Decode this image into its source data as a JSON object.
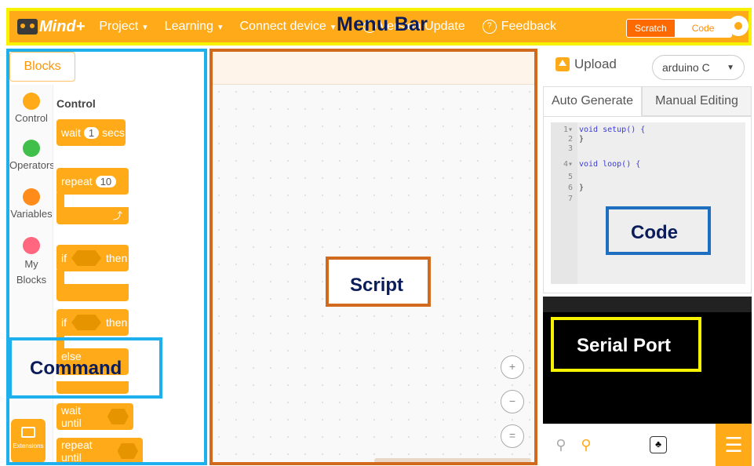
{
  "menubar": {
    "brand": "Mind+",
    "items": [
      {
        "label": "Project",
        "caret": "▾"
      },
      {
        "label": "Learning",
        "caret": "▾"
      },
      {
        "label": "Connect device",
        "caret": "▾"
      }
    ],
    "version_update": "Version Update",
    "feedback": "Feedback",
    "mode_scratch": "Scratch",
    "mode_code": "Code",
    "annotation": "Menu Bar"
  },
  "blocks_panel": {
    "tab": "Blocks",
    "categories": [
      {
        "label": "Control",
        "color": "#ffab19"
      },
      {
        "label": "Operators",
        "color": "#40bf4a"
      },
      {
        "label": "Variables",
        "color": "#ff8c1a"
      },
      {
        "label": "My Blocks",
        "color": "#ff6680"
      }
    ],
    "heading": "Control",
    "blocks": {
      "wait": {
        "prefix": "wait",
        "value": "1",
        "suffix": "secs"
      },
      "repeat": {
        "prefix": "repeat",
        "value": "10"
      },
      "if_then": {
        "prefix": "if",
        "suffix": "then"
      },
      "if_then_else": {
        "prefix": "if",
        "suffix": "then",
        "else": "else"
      },
      "wait_until": "wait until",
      "repeat_until": "repeat until"
    },
    "extensions": "Extensions",
    "annotation": "Command"
  },
  "script": {
    "annotation": "Script",
    "zoom_in": "+",
    "zoom_out": "−",
    "zoom_reset": "="
  },
  "right_panel": {
    "upload": "Upload",
    "board": "arduino C",
    "tabs": [
      "Auto Generate",
      "Manual Editing"
    ],
    "code_lines": [
      {
        "n": "1",
        "fold": "▾",
        "text": "void setup() {"
      },
      {
        "n": "2",
        "fold": "",
        "text": "}"
      },
      {
        "n": "3",
        "fold": "",
        "text": ""
      },
      {
        "n": "4",
        "fold": "▾",
        "text": "void loop() {"
      },
      {
        "n": "5",
        "fold": "",
        "text": ""
      },
      {
        "n": "6",
        "fold": "",
        "text": "}"
      },
      {
        "n": "7",
        "fold": "",
        "text": ""
      }
    ],
    "code_annotation": "Code",
    "serial_annotation": "Serial Port"
  },
  "colors": {
    "accent": "#ffab19",
    "command_box": "#1eb0ec",
    "script_box": "#d26a1e",
    "code_box": "#1e6fc0",
    "serial_box": "#f7f200"
  }
}
